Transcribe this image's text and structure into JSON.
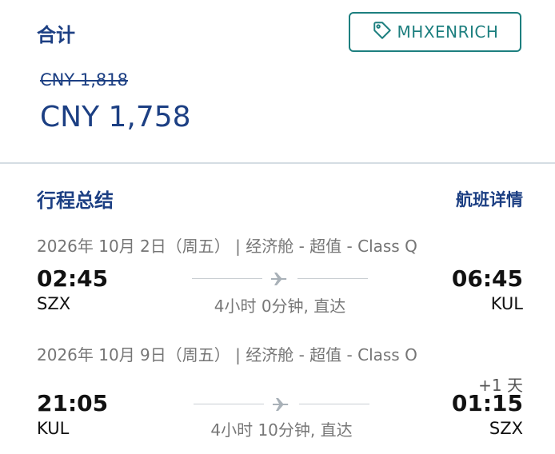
{
  "summary": {
    "total_label": "合计",
    "promo_code": "MHXENRICH",
    "original_price": "CNY 1,818",
    "final_price": "CNY 1,758"
  },
  "itinerary": {
    "title": "行程总结",
    "details_link": "航班详情",
    "flights": [
      {
        "header": "2026年 10月 2日（周五） | 经济舱 - 超值 - Class Q",
        "depart_time": "02:45",
        "depart_code": "SZX",
        "arrive_time": "06:45",
        "arrive_code": "KUL",
        "duration": "4小时 0分钟, 直达",
        "day_offset": ""
      },
      {
        "header": "2026年 10月 9日（周五） | 经济舱 - 超值 - Class O",
        "depart_time": "21:05",
        "depart_code": "KUL",
        "arrive_time": "01:15",
        "arrive_code": "SZX",
        "duration": "4小时 10分钟, 直达",
        "day_offset": "+1 天"
      }
    ]
  },
  "colors": {
    "brand_blue": "#1c3f83",
    "promo_teal": "#1d7f7f",
    "muted_gray": "#757575"
  }
}
